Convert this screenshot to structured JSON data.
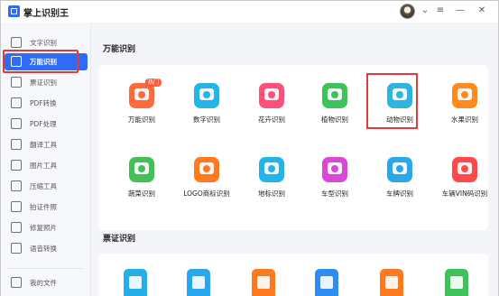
{
  "app": {
    "title": "掌上识别王"
  },
  "window": {
    "avatar_menu": "⌄",
    "menu_icon": "≡",
    "minimize_icon": "—",
    "close_icon": "✕"
  },
  "sidebar": {
    "items": [
      {
        "label": "文字识别",
        "icon": "text-icon"
      },
      {
        "label": "万能识别",
        "icon": "camera-icon",
        "active": true
      },
      {
        "label": "票证识别",
        "icon": "ticket-icon"
      },
      {
        "label": "PDF转换",
        "icon": "pdf-convert-icon"
      },
      {
        "label": "PDF处理",
        "icon": "pdf-process-icon"
      },
      {
        "label": "翻译工具",
        "icon": "translate-icon"
      },
      {
        "label": "图片工具",
        "icon": "image-icon"
      },
      {
        "label": "压缩工具",
        "icon": "compress-icon"
      },
      {
        "label": "拍证件照",
        "icon": "id-photo-icon"
      },
      {
        "label": "修复照片",
        "icon": "repair-photo-icon"
      },
      {
        "label": "语音转换",
        "icon": "voice-icon"
      }
    ],
    "footer": {
      "label": "我的文件",
      "icon": "folder-icon"
    }
  },
  "main": {
    "section1": {
      "title": "万能识别",
      "hot_tag": "热门",
      "tools": [
        {
          "label": "万能识别",
          "color": "#ff6a3d",
          "icon": "universal-icon"
        },
        {
          "label": "数字识别",
          "color": "#25b4e8",
          "icon": "number-icon"
        },
        {
          "label": "花卉识别",
          "color": "#ff4f7b",
          "icon": "flower-icon"
        },
        {
          "label": "植物识别",
          "color": "#3ec35a",
          "icon": "plant-icon"
        },
        {
          "label": "动物识别",
          "color": "#2fb3e0",
          "icon": "animal-icon"
        },
        {
          "label": "水果识别",
          "color": "#ff8a1f",
          "icon": "fruit-icon"
        },
        {
          "label": "蔬菜识别",
          "color": "#45c057",
          "icon": "vegetable-icon"
        },
        {
          "label": "LOGO商标识别",
          "color": "#ff7a1e",
          "icon": "logo-icon"
        },
        {
          "label": "地标识别",
          "color": "#25b4e8",
          "icon": "landmark-icon"
        },
        {
          "label": "车型识别",
          "color": "#d84ad6",
          "icon": "car-model-icon"
        },
        {
          "label": "车牌识别",
          "color": "#2aa8ea",
          "icon": "license-plate-icon"
        },
        {
          "label": "车辆VIN码识别",
          "color": "#ff4a4a",
          "icon": "vin-icon"
        }
      ]
    },
    "section2": {
      "title": "票证识别",
      "tools": [
        {
          "color": "#25aee8",
          "icon": "id-card-icon"
        },
        {
          "color": "#27a7ee",
          "icon": "bank-card-icon"
        },
        {
          "color": "#ff7a1e",
          "icon": "business-license-icon"
        },
        {
          "color": "#2f8cf0",
          "icon": "invoice-icon"
        },
        {
          "color": "#ff7a1e",
          "icon": "driver-license-icon"
        },
        {
          "color": "#3ec35a",
          "icon": "passport-icon"
        }
      ]
    }
  }
}
